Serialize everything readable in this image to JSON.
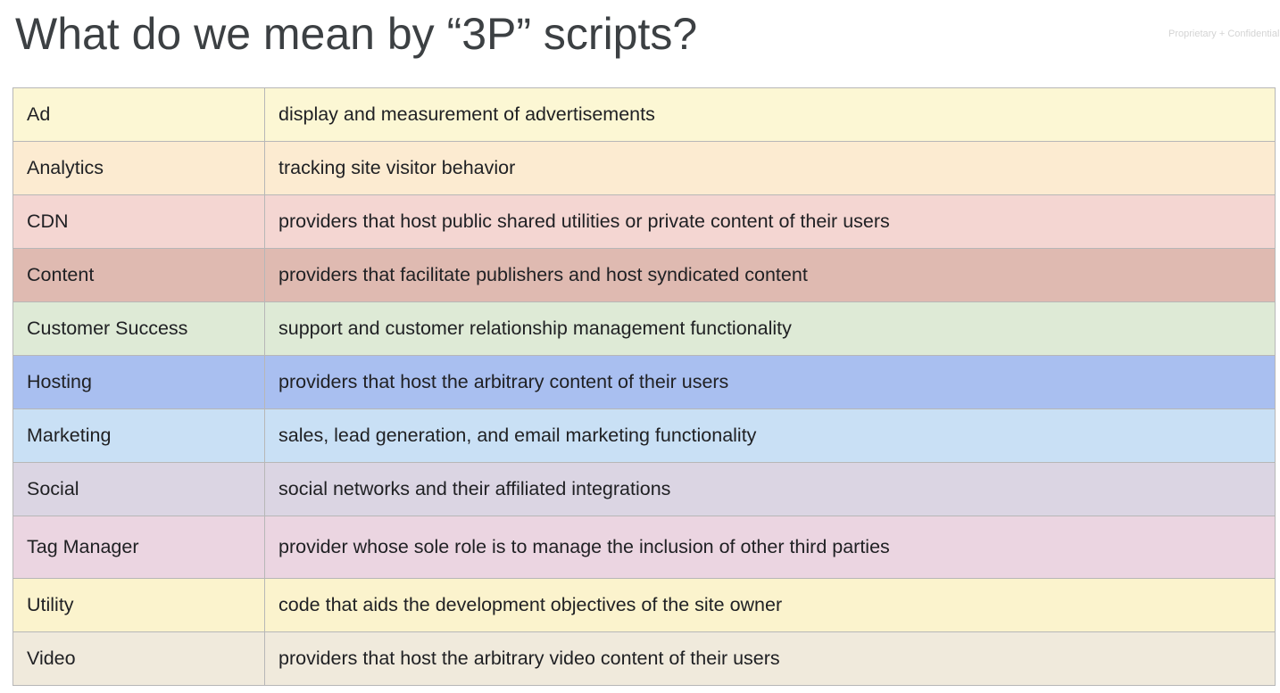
{
  "slide": {
    "title": "What do we mean by “3P” scripts?",
    "confidential_label": "Proprietary + Confidential"
  },
  "table": {
    "rows": [
      {
        "category": "Ad",
        "description": "display and measurement of advertisements",
        "color": "#fcf7d4"
      },
      {
        "category": "Analytics",
        "description": "tracking site visitor behavior",
        "color": "#fcebd1"
      },
      {
        "category": "CDN",
        "description": "providers that host public shared utilities or private content of their users",
        "color": "#f4d6d2"
      },
      {
        "category": "Content",
        "description": "providers that facilitate publishers and host syndicated content",
        "color": "#dfbab1"
      },
      {
        "category": "Customer Success",
        "description": "support and customer relationship management functionality",
        "color": "#deead6"
      },
      {
        "category": "Hosting",
        "description": "providers that host the arbitrary content of their users",
        "color": "#a9bff0"
      },
      {
        "category": "Marketing",
        "description": "sales, lead generation, and email marketing functionality",
        "color": "#c9e0f5"
      },
      {
        "category": "Social",
        "description": "social networks and their affiliated integrations",
        "color": "#dbd5e3"
      },
      {
        "category": "Tag Manager",
        "description": "provider whose sole role is to manage the inclusion of other third parties",
        "color": "#ebd5e1"
      },
      {
        "category": "Utility",
        "description": "code that aids the development objectives of the site owner",
        "color": "#fbf3cd"
      },
      {
        "category": "Video",
        "description": "providers that host the arbitrary video content of their users",
        "color": "#f0eadc"
      }
    ]
  }
}
